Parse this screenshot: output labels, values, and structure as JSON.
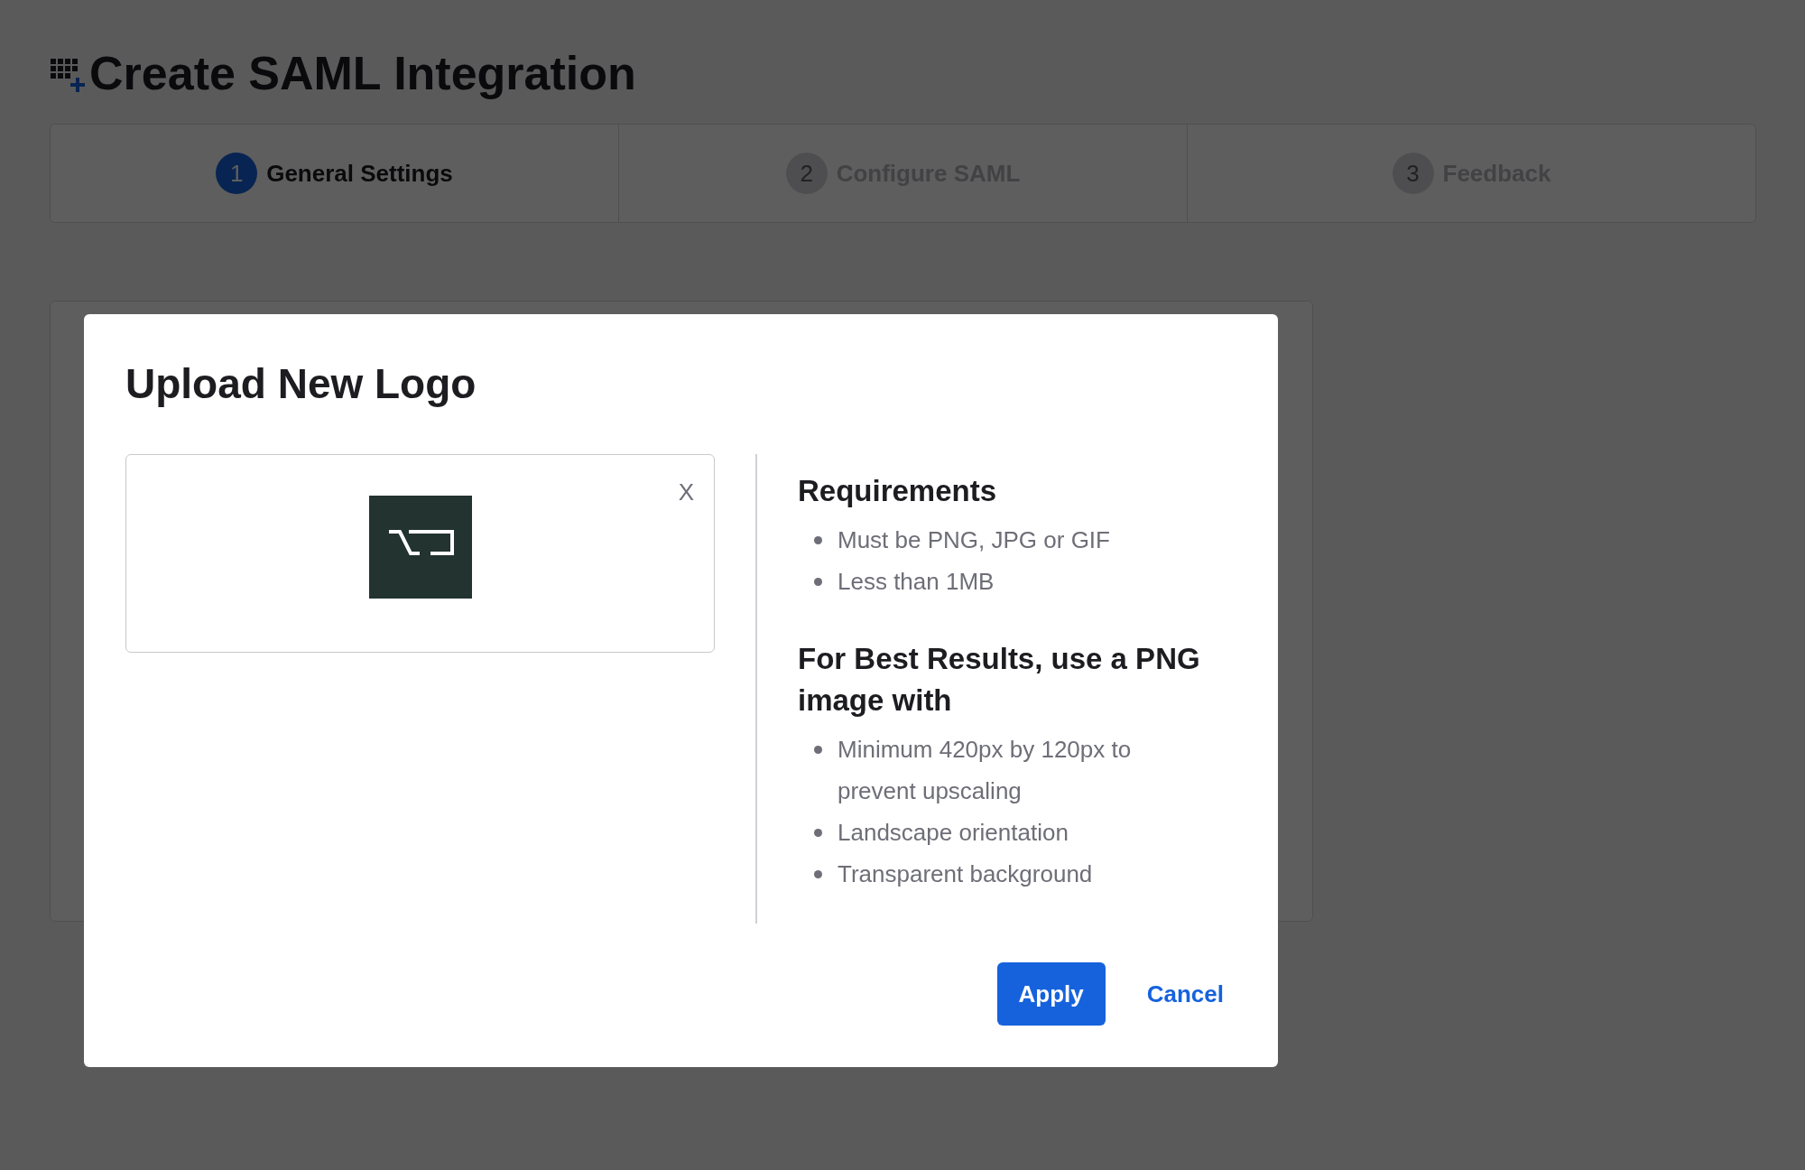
{
  "page": {
    "title": "Create SAML Integration"
  },
  "steps": [
    {
      "number": "1",
      "label": "General Settings",
      "selected": true
    },
    {
      "number": "2",
      "label": "Configure SAML",
      "selected": false
    },
    {
      "number": "3",
      "label": "Feedback",
      "selected": false
    }
  ],
  "modal": {
    "title": "Upload New Logo",
    "dropzone": {
      "close": "X"
    },
    "sections": [
      {
        "heading": "Requirements",
        "items": [
          "Must be PNG, JPG or GIF",
          "Less than 1MB"
        ]
      },
      {
        "heading": "For Best Results, use a PNG image with",
        "items": [
          "Minimum 420px by 120px to prevent upscaling",
          "Landscape orientation",
          "Transparent background"
        ]
      }
    ],
    "buttons": [
      {
        "label": "Apply",
        "kind": "primary"
      },
      {
        "label": "Cancel",
        "kind": "link"
      }
    ]
  }
}
